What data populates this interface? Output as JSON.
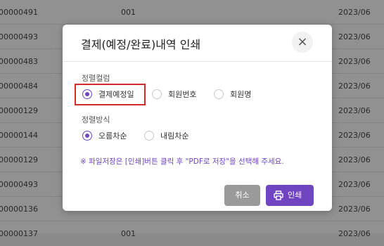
{
  "background_rows": [
    {
      "id": "00000491",
      "code": "001",
      "date": "2023/06"
    },
    {
      "id": "00000493",
      "code": "",
      "date": "2023/06"
    },
    {
      "id": "00000483",
      "code": "",
      "date": "2023/06"
    },
    {
      "id": "00000484",
      "code": "",
      "date": "2023/06"
    },
    {
      "id": "00000129",
      "code": "",
      "date": "2023/06"
    },
    {
      "id": "00000144",
      "code": "",
      "date": "2023/06"
    },
    {
      "id": "00000129",
      "code": "",
      "date": "2023/06"
    },
    {
      "id": "00000493",
      "code": "",
      "date": "2023/06"
    },
    {
      "id": "00000136",
      "code": "",
      "date": "2023/06"
    },
    {
      "id": "00000137",
      "code": "001",
      "date": "2023/06"
    }
  ],
  "modal": {
    "title": "결제(예정/완료)내역 인쇄",
    "close_icon": "close-icon",
    "sort_column": {
      "label": "정렬컬럼",
      "options": [
        "결제예정일",
        "회원번호",
        "회원명"
      ],
      "selected": "결제예정일"
    },
    "sort_order": {
      "label": "정렬방식",
      "options": [
        "오름차순",
        "내림차순"
      ],
      "selected": "오름차순"
    },
    "notice": "※ 파일저장은 [인쇄]버튼 클릭 후 \"PDF로 저장\"을 선택해 주세요.",
    "cancel_label": "취소",
    "print_label": "인쇄",
    "print_icon": "printer-icon",
    "accent_color": "#6f45c2",
    "highlight_color": "#d42a2a"
  }
}
